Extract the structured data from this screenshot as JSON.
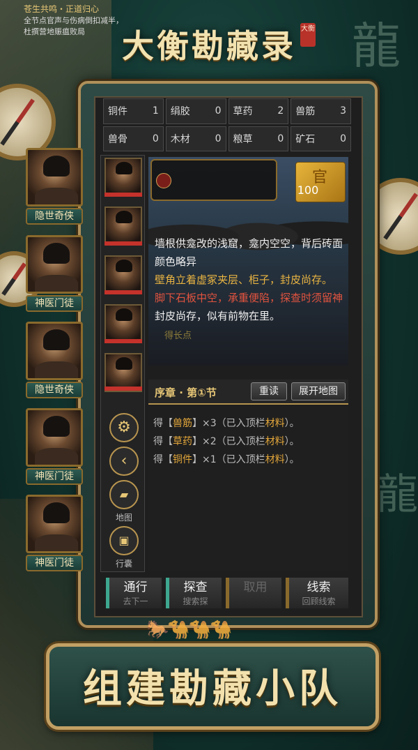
{
  "title": "大衡勘藏录",
  "seal": "大衡",
  "resources": [
    {
      "name": "铜件",
      "value": "1"
    },
    {
      "name": "绢胶",
      "value": "0"
    },
    {
      "name": "草药",
      "value": "2"
    },
    {
      "name": "兽筋",
      "value": "3"
    },
    {
      "name": "兽骨",
      "value": "0"
    },
    {
      "name": "木材",
      "value": "0"
    },
    {
      "name": "粮草",
      "value": "0"
    },
    {
      "name": "矿石",
      "value": "0"
    }
  ],
  "heroes": [
    {
      "label": "隐世奇侠"
    },
    {
      "label": "神医门徒"
    },
    {
      "label": "隐世奇侠"
    },
    {
      "label": "神医门徒"
    },
    {
      "label": "神医门徒"
    }
  ],
  "side_buttons": {
    "map_label": "地图",
    "bag_label": "行囊",
    "settings_icon": "gear-icon",
    "back_icon": "chevron-left-icon"
  },
  "event": {
    "title": "苍生共鸣・正道归心",
    "desc": "全节点官声与伤病倒扣减半，杜撰营地赈瘟败局"
  },
  "rank": {
    "char": "官",
    "value": "100"
  },
  "story": {
    "line1": "墙根供龛改的浅窟，龛内空空，背后砖面颜色略异",
    "line2": "壁角立着虚冢夹层、柜子，封皮尚存。",
    "line3": "脚下石板中空，承重便陷，探查时须留神",
    "faded": "得长点",
    "line4": "封皮尚存，似有前物在里。"
  },
  "chapter": {
    "label": "序章 · 第①节",
    "reread": "重读",
    "expand_map": "展开地图"
  },
  "log": [
    {
      "prefix": "得【",
      "item": "兽筋",
      "suffix": "】×3（已入顶栏",
      "tag": "材料",
      "end": "）。"
    },
    {
      "prefix": "得【",
      "item": "草药",
      "suffix": "】×2（已入顶栏",
      "tag": "材料",
      "end": "）。"
    },
    {
      "prefix": "得【",
      "item": "铜件",
      "suffix": "】×1（已入顶栏",
      "tag": "材料",
      "end": "）。"
    }
  ],
  "actions": [
    {
      "label": "通行",
      "sub": "去下一"
    },
    {
      "label": "探查",
      "sub": "搜索探"
    },
    {
      "label": "取用",
      "sub": ""
    },
    {
      "label": "线索",
      "sub": "回顾线索"
    }
  ],
  "banner": "组建勘藏小队",
  "colors": {
    "gold": "#e6c676",
    "red": "#e2533f",
    "teal": "#3ea78f"
  }
}
